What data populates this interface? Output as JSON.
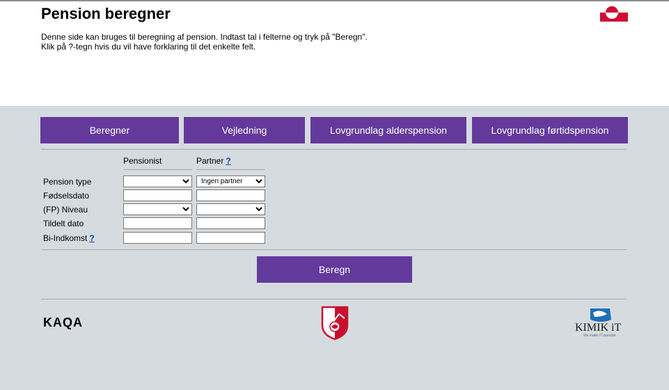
{
  "header": {
    "title": "Pension beregner",
    "intro_line1": "Denne side kan bruges til beregning af pension. Indtast tal i felterne og tryk på \"Beregn\".",
    "intro_line2": "Klik på ?-tegn hvis du vil have forklaring til det enkelte felt."
  },
  "tabs": [
    "Beregner",
    "Vejledning",
    "Lovgrundlag alderspension",
    "Lovgrundlag førtidspension"
  ],
  "form": {
    "col_pensionist": "Pensionist",
    "col_partner": "Partner",
    "help_mark": "?",
    "rows": {
      "pension_type": "Pension type",
      "birthdate": "Fødselsdato",
      "fp_level": "(FP) Niveau",
      "granted_date": "Tildelt dato",
      "side_income": "Bi-Indkomst"
    },
    "partner_pension_type_value": "Ingen partner"
  },
  "submit_label": "Beregn",
  "footer": {
    "kaqa": "KAQA",
    "kimik": "KIMIK iT",
    "kimik_tagline": "We make IT possible"
  },
  "colors": {
    "accent": "#633a9b",
    "page_bg": "#d6dbdf",
    "help_link": "#0645ad"
  }
}
